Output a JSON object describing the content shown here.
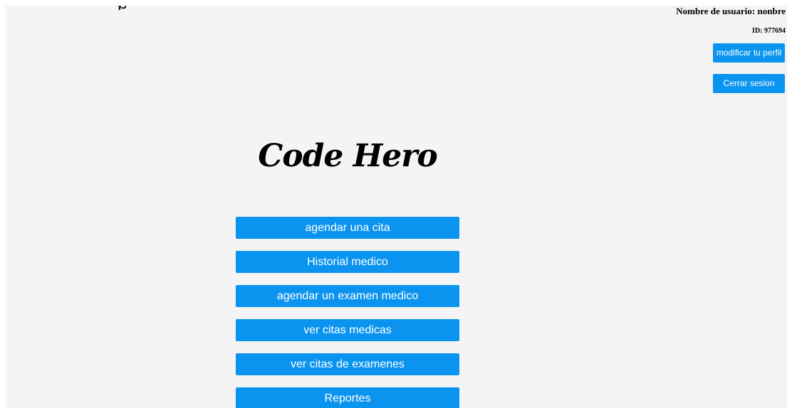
{
  "top_fragment": "p",
  "user": {
    "username_label": "Nombre de usuario: nonbre",
    "id_label": "ID: 977694"
  },
  "actions": {
    "modify_profile": "modificar tu perfil",
    "logout": "Cerrar sesion"
  },
  "brand": {
    "title": "Code Hero"
  },
  "menu": [
    {
      "label": "agendar una cita"
    },
    {
      "label": "Historial medico"
    },
    {
      "label": "agendar un examen medico"
    },
    {
      "label": "ver citas medicas"
    },
    {
      "label": "ver citas de examenes"
    },
    {
      "label": "Reportes"
    }
  ],
  "colors": {
    "accent": "#0b94ef",
    "background": "#f4f4f4"
  }
}
